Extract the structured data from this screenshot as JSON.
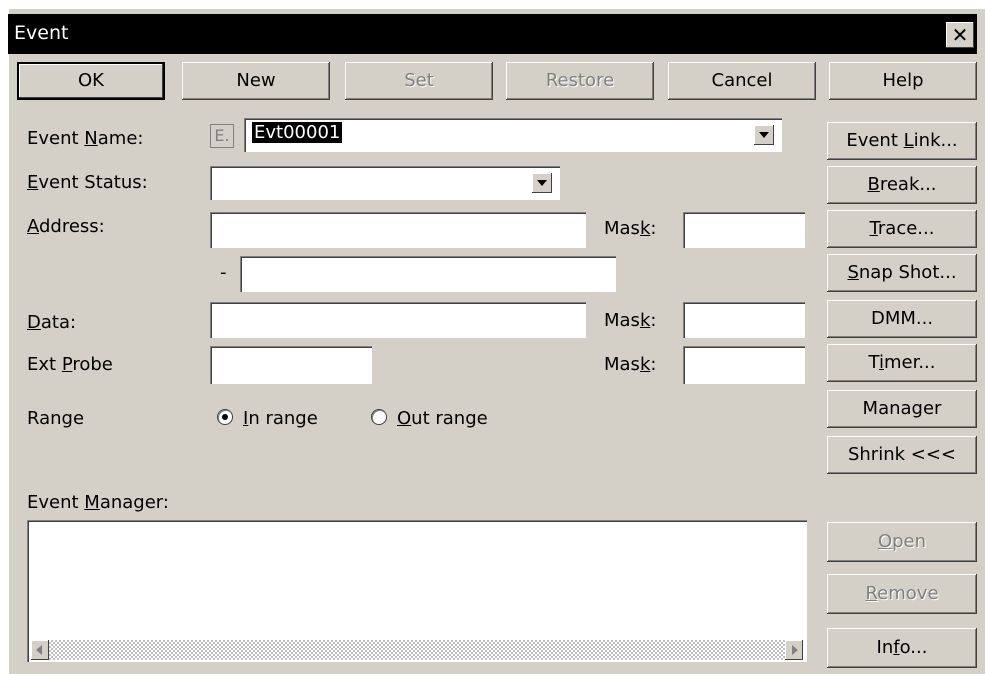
{
  "window": {
    "title": "Event"
  },
  "toolbar": {
    "ok": "OK",
    "new": "New",
    "set": "Set",
    "restore": "Restore",
    "cancel": "Cancel",
    "help": "Help"
  },
  "form": {
    "event_name_label_pre": "Event ",
    "event_name_label_key": "N",
    "event_name_label_post": "ame:",
    "event_badge": "E.",
    "event_name_value": "Evt00001",
    "event_status_label_key": "E",
    "event_status_label_post": "vent Status:",
    "event_status_value": "",
    "address_label_key": "A",
    "address_label_post": "ddress:",
    "address_value": "",
    "address_end_value": "",
    "range_dash": "-",
    "mask_label_pre": "Mas",
    "mask_label_key": "k",
    "mask_label_post": ":",
    "address_mask_value": "",
    "data_label_key": "D",
    "data_label_post": "ata:",
    "data_value": "",
    "data_mask_value": "",
    "ext_probe_label_pre": "Ext ",
    "ext_probe_label_key": "P",
    "ext_probe_label_post": "robe",
    "ext_probe_value": "",
    "ext_probe_mask_value": "",
    "range_label": "Range",
    "in_range_key": "I",
    "in_range_post": "n range",
    "out_range_key": "O",
    "out_range_post": "ut range",
    "range_selected": "In range"
  },
  "side_buttons": {
    "event_link_pre": "Event ",
    "event_link_key": "L",
    "event_link_post": "ink...",
    "break_key": "B",
    "break_post": "reak...",
    "trace_key": "T",
    "trace_post": "race...",
    "snap_key": "S",
    "snap_post": "nap Shot...",
    "dmm": "DMM...",
    "timer_pre": "T",
    "timer_key": "i",
    "timer_post": "mer...",
    "manager": "Manager",
    "shrink": "Shrink <<<"
  },
  "manager": {
    "label_pre": "Event ",
    "label_key": "M",
    "label_post": "anager:",
    "open_key": "O",
    "open_post": "pen",
    "remove_key": "R",
    "remove_post": "emove",
    "info_pre": "In",
    "info_key": "f",
    "info_post": "o..."
  }
}
